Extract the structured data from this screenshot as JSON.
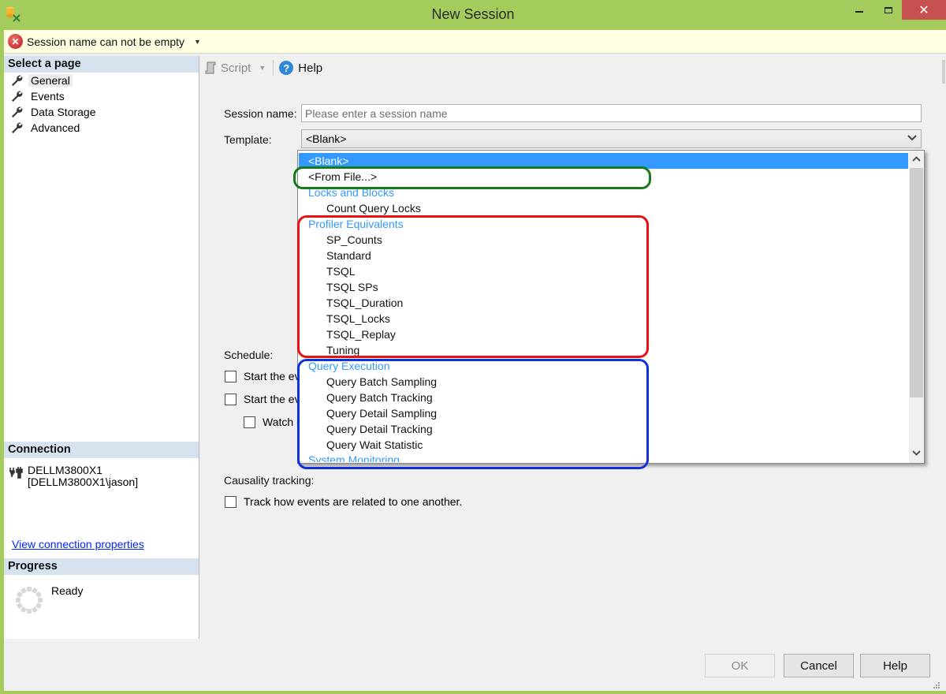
{
  "window": {
    "title": "New Session",
    "minimize_label": "minimize",
    "maximize_label": "maximize",
    "close_label": "✕"
  },
  "error_bar": {
    "message": "Session name can not be empty",
    "icon": "error-icon",
    "caret": "▼"
  },
  "sidebar": {
    "select_page_header": "Select a page",
    "items": [
      {
        "label": "General",
        "icon": "wrench-icon",
        "selected": true
      },
      {
        "label": "Events",
        "icon": "wrench-icon",
        "selected": false
      },
      {
        "label": "Data Storage",
        "icon": "wrench-icon",
        "selected": false
      },
      {
        "label": "Advanced",
        "icon": "wrench-icon",
        "selected": false
      }
    ],
    "connection_header": "Connection",
    "connection_server": "DELLM3800X1",
    "connection_user": "[DELLM3800X1\\jason]",
    "connection_link": "View connection properties",
    "progress_header": "Progress",
    "progress_status": "Ready"
  },
  "toolbar": {
    "script_label": "Script",
    "script_caret": "▼",
    "help_label": "Help",
    "help_icon_glyph": "?"
  },
  "form": {
    "session_name_label": "Session name:",
    "session_name_value": "",
    "session_name_placeholder": "Please enter a session name",
    "template_label": "Template:",
    "template_value": "<Blank>",
    "schedule_label": "Schedule:",
    "schedule_options": [
      {
        "label": "Start the eve",
        "checked": false
      },
      {
        "label": "Start the eve",
        "checked": false
      },
      {
        "label": "Watch li",
        "checked": false
      }
    ],
    "causality_label": "Causality tracking:",
    "causality_option": {
      "label": "Track how events are related to one another.",
      "checked": false
    }
  },
  "template_dropdown": {
    "items": [
      {
        "label": "<Blank>",
        "kind": "item",
        "selected": true
      },
      {
        "label": "<From File...>",
        "kind": "item",
        "selected": false
      },
      {
        "label": "Locks and Blocks",
        "kind": "group",
        "selected": false
      },
      {
        "label": "Count Query Locks",
        "kind": "child",
        "selected": false
      },
      {
        "label": "Profiler Equivalents",
        "kind": "group",
        "selected": false
      },
      {
        "label": "SP_Counts",
        "kind": "child",
        "selected": false
      },
      {
        "label": "Standard",
        "kind": "child",
        "selected": false
      },
      {
        "label": "TSQL",
        "kind": "child",
        "selected": false
      },
      {
        "label": "TSQL SPs",
        "kind": "child",
        "selected": false
      },
      {
        "label": "TSQL_Duration",
        "kind": "child",
        "selected": false
      },
      {
        "label": "TSQL_Locks",
        "kind": "child",
        "selected": false
      },
      {
        "label": "TSQL_Replay",
        "kind": "child",
        "selected": false
      },
      {
        "label": "Tuning",
        "kind": "child",
        "selected": false
      },
      {
        "label": "Query Execution",
        "kind": "group",
        "selected": false
      },
      {
        "label": "Query Batch Sampling",
        "kind": "child",
        "selected": false
      },
      {
        "label": "Query Batch Tracking",
        "kind": "child",
        "selected": false
      },
      {
        "label": "Query Detail Sampling",
        "kind": "child",
        "selected": false
      },
      {
        "label": "Query Detail Tracking",
        "kind": "child",
        "selected": false
      },
      {
        "label": "Query Wait Statistic",
        "kind": "child",
        "selected": false
      },
      {
        "label": "System Monitoring",
        "kind": "group",
        "selected": false
      }
    ],
    "scroll_fraction_visible": 0.75
  },
  "annotations": {
    "green": "#1a7a1a",
    "red": "#e81010",
    "blue": "#1030e0"
  },
  "footer": {
    "ok_label": "OK",
    "cancel_label": "Cancel",
    "help_label": "Help"
  },
  "colors": {
    "window_frame": "#a3cc5c",
    "close_button": "#c75050",
    "selection": "#3399ff",
    "group_header_text": "#3399ff",
    "link": "#0026ff",
    "error_bar_bg": "#ffffe1"
  }
}
